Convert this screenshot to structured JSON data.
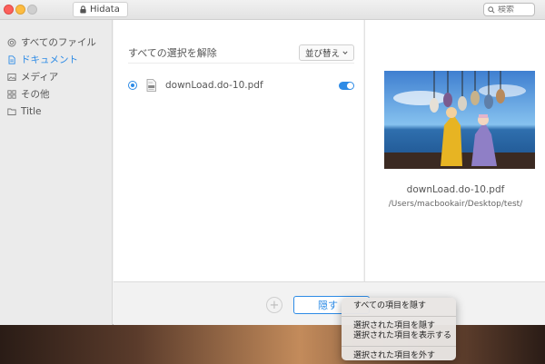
{
  "window": {
    "app_title": "Hidata",
    "search_placeholder": "検索"
  },
  "sidebar": {
    "items": [
      {
        "label": "すべてのファイル",
        "icon": "all-files-icon",
        "active": false
      },
      {
        "label": "ドキュメント",
        "icon": "document-icon",
        "active": true
      },
      {
        "label": "メディア",
        "icon": "media-icon",
        "active": false
      },
      {
        "label": "その他",
        "icon": "other-icon",
        "active": false
      },
      {
        "label": "Title",
        "icon": "folder-icon",
        "active": false
      }
    ]
  },
  "main": {
    "deselect_all": "すべての選択を解除",
    "sort_label": "並び替え",
    "files": [
      {
        "name": "downLoad.do-10.pdf",
        "selected": true,
        "hidden_toggle": true
      }
    ]
  },
  "preview": {
    "file_name": "downLoad.do-10.pdf",
    "file_path": "/Users/macbookair/Desktop/test/"
  },
  "bottom": {
    "add_label": "+",
    "hide_button": "隠す"
  },
  "context_menu": {
    "items": [
      "すべての項目を隠す",
      "選択された項目を隠す",
      "選択された項目を表示する",
      "選択された項目を外す"
    ]
  },
  "colors": {
    "accent": "#2d8be6"
  }
}
